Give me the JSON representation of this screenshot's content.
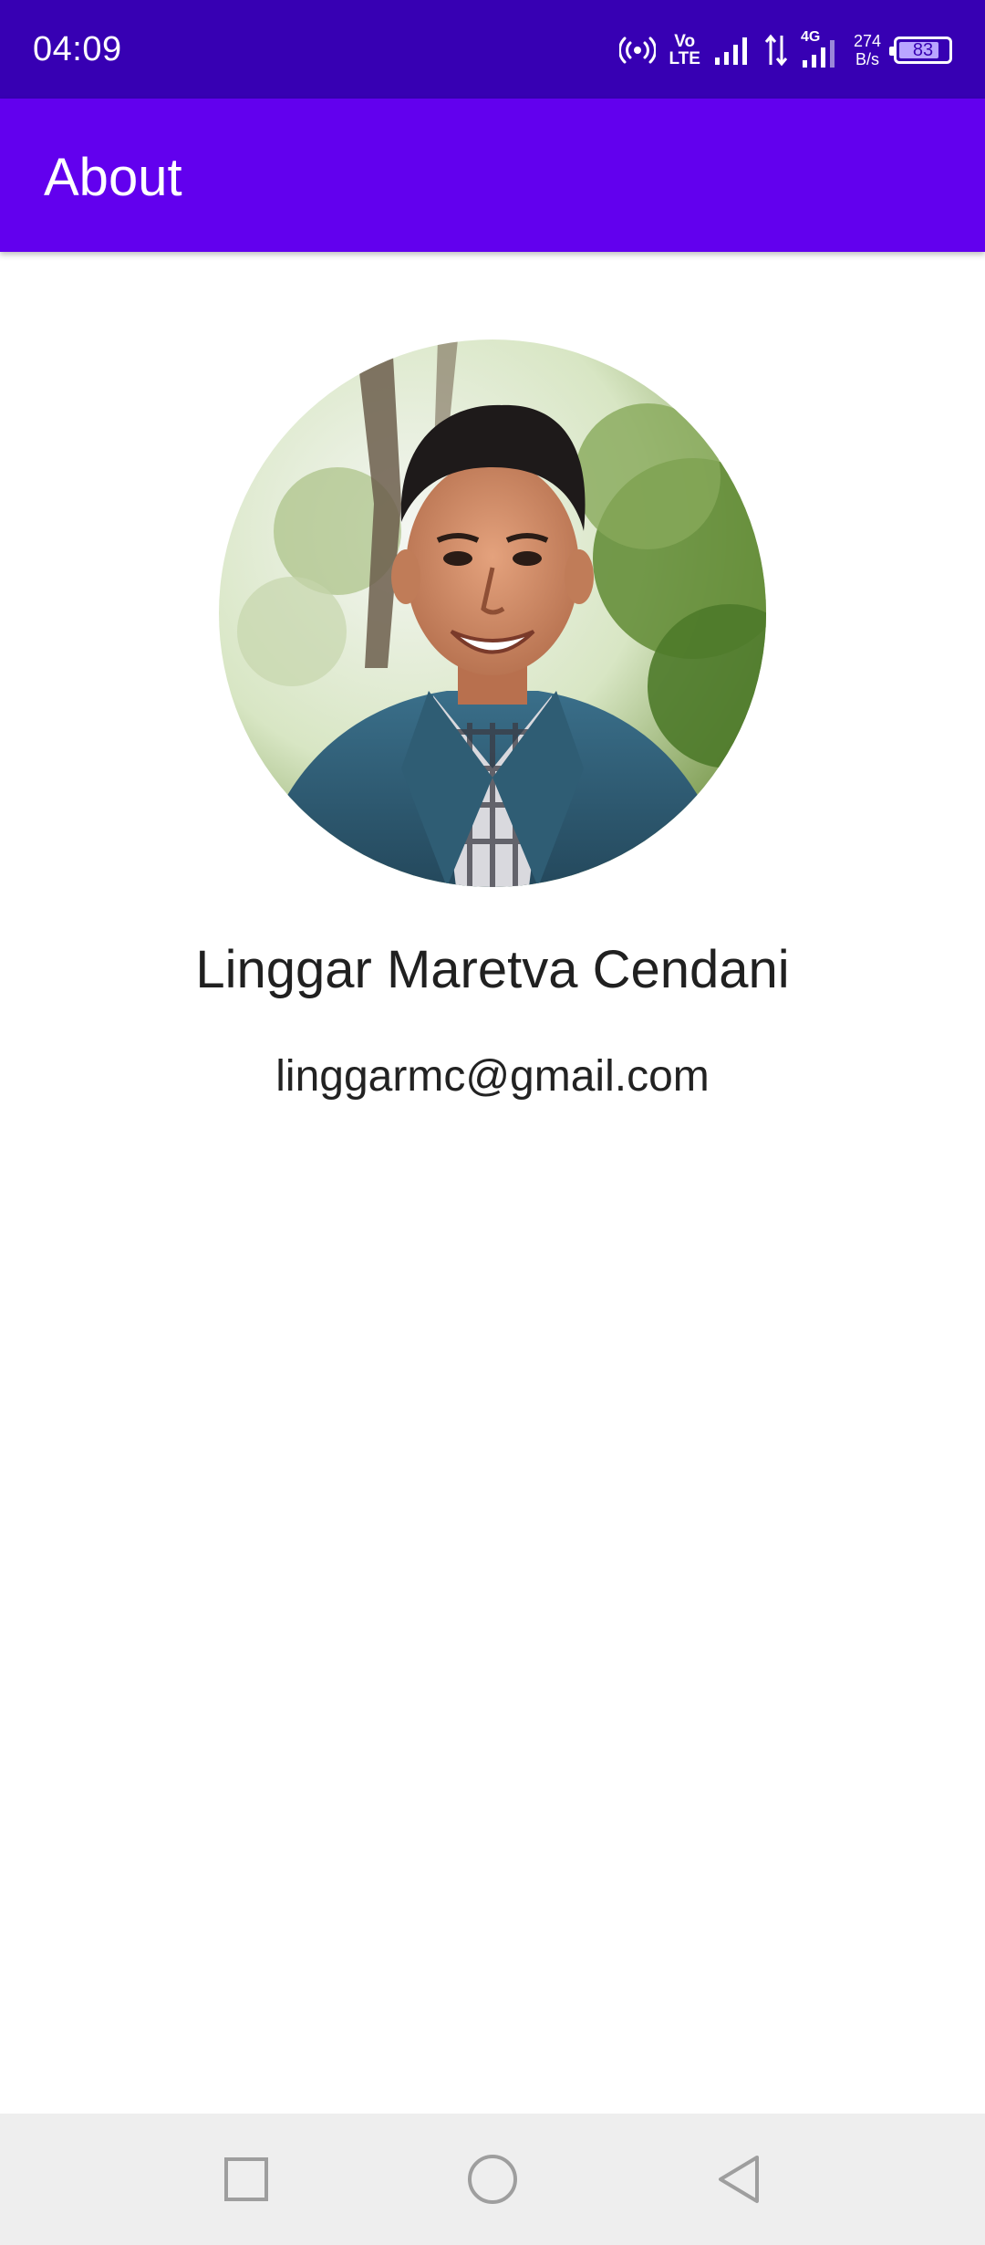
{
  "status_bar": {
    "time": "04:09",
    "volte_top": "Vo",
    "volte_bottom": "LTE",
    "network_type": "4G",
    "net_speed_value": "274",
    "net_speed_unit": "B/s",
    "battery_level": "83",
    "battery_fraction": 0.83,
    "icons": [
      "hotspot-icon",
      "volte-icon",
      "signal-icon",
      "data-arrows-icon",
      "signal-4g-icon",
      "battery-icon"
    ]
  },
  "app_bar": {
    "title": "About"
  },
  "profile": {
    "name": "Linggar Maretva Cendani",
    "email": "linggarmc@gmail.com"
  },
  "nav_bar": {
    "icons": [
      "recents-square-icon",
      "home-circle-icon",
      "back-triangle-icon"
    ]
  },
  "colors": {
    "status_bar": "#3700b3",
    "app_bar": "#6200ee",
    "background": "#ffffff",
    "nav_bar": "#eeeeee"
  }
}
